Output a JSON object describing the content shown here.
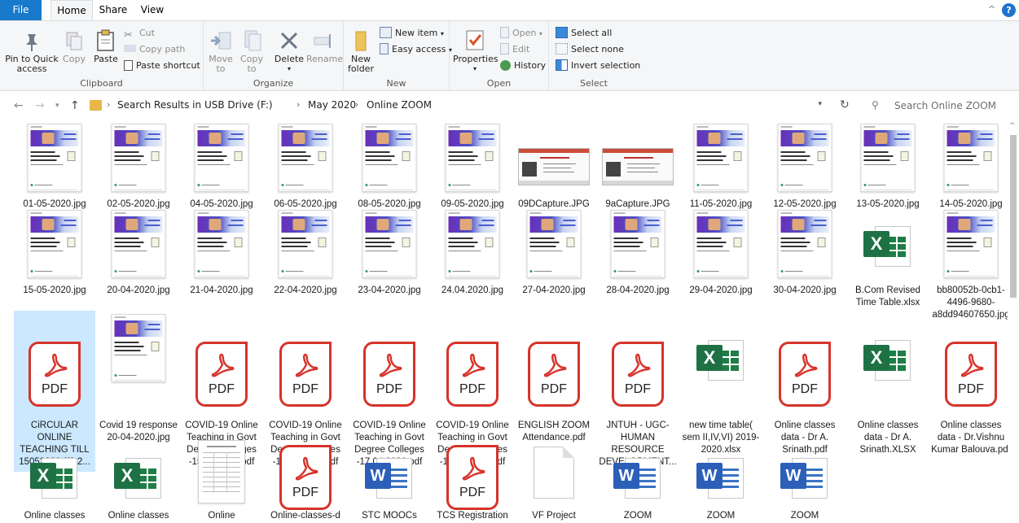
{
  "tabs": {
    "file": "File",
    "home": "Home",
    "share": "Share",
    "view": "View"
  },
  "ribbon": {
    "clipboard": {
      "label": "Clipboard",
      "pin": "Pin to Quick\naccess",
      "pin_1": "Pin to Quick",
      "pin_2": "access",
      "copy": "Copy",
      "paste": "Paste",
      "cut": "Cut",
      "copy_path": "Copy path",
      "paste_shortcut": "Paste shortcut"
    },
    "organize": {
      "label": "Organize",
      "move_1": "Move",
      "move_2": "to",
      "copy_1": "Copy",
      "copy_2": "to",
      "delete": "Delete",
      "rename": "Rename"
    },
    "new": {
      "label": "New",
      "new_folder_1": "New",
      "new_folder_2": "folder",
      "new_item": "New item",
      "easy_access": "Easy access"
    },
    "open": {
      "label": "Open",
      "properties": "Properties",
      "open": "Open",
      "edit": "Edit",
      "history": "History"
    },
    "select": {
      "label": "Select",
      "select_all": "Select all",
      "select_none": "Select none",
      "invert": "Invert selection"
    }
  },
  "address": {
    "crumbs": [
      "Search Results in USB Drive (F:)",
      "May 2020",
      "Online ZOOM"
    ],
    "search_placeholder": "Search Online ZOOM"
  },
  "files": [
    {
      "name": "01-05-2020.jpg",
      "type": "zoom"
    },
    {
      "name": "02-05-2020.jpg",
      "type": "zoom"
    },
    {
      "name": "04-05-2020.jpg",
      "type": "zoom"
    },
    {
      "name": "06-05-2020.jpg",
      "type": "zoom"
    },
    {
      "name": "08-05-2020.jpg",
      "type": "zoom"
    },
    {
      "name": "09-05-2020.jpg",
      "type": "zoom"
    },
    {
      "name": "09DCapture.JPG",
      "type": "capture"
    },
    {
      "name": "9aCapture.JPG",
      "type": "capture"
    },
    {
      "name": "11-05-2020.jpg",
      "type": "zoom"
    },
    {
      "name": "12-05-2020.jpg",
      "type": "zoom"
    },
    {
      "name": "13-05-2020.jpg",
      "type": "zoom"
    },
    {
      "name": "14-05-2020.jpg",
      "type": "zoom"
    },
    {
      "name": "15-05-2020.jpg",
      "type": "zoom"
    },
    {
      "name": "20-04-2020.jpg",
      "type": "zoom"
    },
    {
      "name": "21-04-2020.jpg",
      "type": "zoom"
    },
    {
      "name": "22-04-2020.jpg",
      "type": "zoom"
    },
    {
      "name": "23-04-2020.jpg",
      "type": "zoom"
    },
    {
      "name": "24.04.2020.jpg",
      "type": "zoom"
    },
    {
      "name": "27-04-2020.jpg",
      "type": "zoom"
    },
    {
      "name": "28-04-2020.jpg",
      "type": "zoom"
    },
    {
      "name": "29-04-2020.jpg",
      "type": "zoom"
    },
    {
      "name": "30-04-2020.jpg",
      "type": "zoom"
    },
    {
      "name": "B.Com Revised Time Table.xlsx",
      "type": "excel"
    },
    {
      "name": "bb80052b-0cb1-4496-9680-a8dd94607650.jpg",
      "type": "zoom"
    },
    {
      "name": "CiRCULAR ONLINE TEACHING TILL 15052020 (2) 2...",
      "type": "pdf",
      "selected": true
    },
    {
      "name": "Covid 19 response 20-04-2020.jpg",
      "type": "zoom"
    },
    {
      "name": "COVID-19 Online Teaching in Govt Degree Colleges -15.04.2020.pdf",
      "type": "pdf"
    },
    {
      "name": "COVID-19 Online Teaching in Govt Degree Colleges -16.04.2020.pdf",
      "type": "pdf"
    },
    {
      "name": "COVID-19 Online Teaching in Govt Degree Colleges -17.04.2020.pdf",
      "type": "pdf"
    },
    {
      "name": "COVID-19 Online Teaching in Govt Degree Colleges -18.04.2020.pdf",
      "type": "pdf"
    },
    {
      "name": "ENGLISH ZOOM Attendance.pdf",
      "type": "pdf"
    },
    {
      "name": "JNTUH - UGC-HUMAN RESOURCE DEVELOPMENT...",
      "type": "pdf"
    },
    {
      "name": "new time table( sem II,IV,VI) 2019-2020.xlsx",
      "type": "excel"
    },
    {
      "name": "Online classes data - Dr A. Srinath.pdf",
      "type": "pdf"
    },
    {
      "name": "Online classes data - Dr A. Srinath.XLSX",
      "type": "excel"
    },
    {
      "name": "Online classes data - Dr.Vishnu Kumar Balouva.pdf",
      "type": "pdf"
    },
    {
      "name": "Online classes",
      "type": "excel"
    },
    {
      "name": "Online classes",
      "type": "excel"
    },
    {
      "name": "Online",
      "type": "table"
    },
    {
      "name": "Online-classes-d",
      "type": "pdf"
    },
    {
      "name": "STC MOOCs",
      "type": "word"
    },
    {
      "name": "TCS Registration",
      "type": "pdf"
    },
    {
      "name": "VF Project",
      "type": "blank"
    },
    {
      "name": "ZOOM",
      "type": "word"
    },
    {
      "name": "ZOOM",
      "type": "word"
    },
    {
      "name": "ZOOM",
      "type": "word"
    }
  ]
}
